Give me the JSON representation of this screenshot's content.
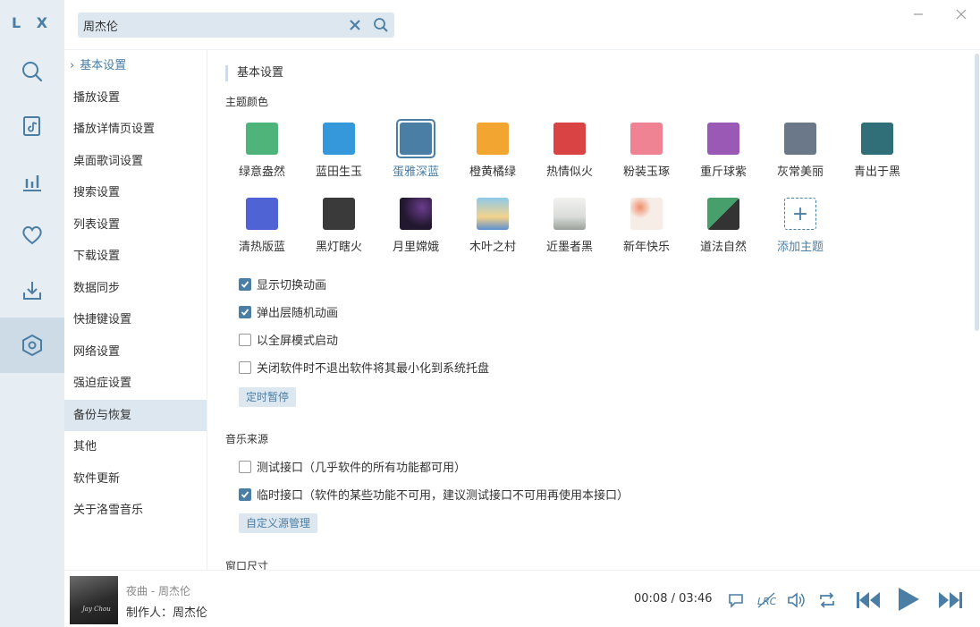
{
  "app": {
    "logo": "L X"
  },
  "search": {
    "value": "周杰伦",
    "placeholder": ""
  },
  "submenu": {
    "items": [
      "基本设置",
      "播放设置",
      "播放详情页设置",
      "桌面歌词设置",
      "搜索设置",
      "列表设置",
      "下载设置",
      "数据同步",
      "快捷键设置",
      "网络设置",
      "强迫症设置",
      "备份与恢复",
      "其他",
      "软件更新",
      "关于洛雪音乐"
    ]
  },
  "content": {
    "section_title": "基本设置",
    "theme_title": "主题颜色",
    "themes": [
      {
        "name": "绿意盎然",
        "color": "#4fb47a"
      },
      {
        "name": "蓝田生玉",
        "color": "#3498db"
      },
      {
        "name": "蛋雅深蓝",
        "color": "#4a7ea5"
      },
      {
        "name": "橙黄橘绿",
        "color": "#f2a531"
      },
      {
        "name": "热情似火",
        "color": "#d94343"
      },
      {
        "name": "粉装玉琢",
        "color": "#ef8393"
      },
      {
        "name": "重斤球紫",
        "color": "#9b59b6"
      },
      {
        "name": "灰常美丽",
        "color": "#6b7889"
      },
      {
        "name": "青出于黑",
        "color": "#306e78"
      },
      {
        "name": "清热版蓝",
        "color": "#4f63d4"
      },
      {
        "name": "黑灯瞎火",
        "color": "#3a3a3a"
      },
      {
        "name": "月里嫦娥",
        "color": "#22182f"
      },
      {
        "name": "木叶之村",
        "color": "#8ec9ea"
      },
      {
        "name": "近墨者黑",
        "color": "#d9dcd8"
      },
      {
        "name": "新年快乐",
        "color": "#f6ede7"
      },
      {
        "name": "道法自然",
        "color": "#47a06c"
      }
    ],
    "add_theme": "添加主题",
    "add_theme_glyph": "+",
    "checks": [
      {
        "label": "显示切换动画",
        "checked": true
      },
      {
        "label": "弹出层随机动画",
        "checked": true
      },
      {
        "label": "以全屏模式启动",
        "checked": false
      },
      {
        "label": "关闭软件时不退出软件将其最小化到系统托盘",
        "checked": false
      }
    ],
    "timer_button": "定时暂停",
    "music_source_title": "音乐来源",
    "sources": [
      {
        "label": "测试接口（几乎软件的所有功能都可用）",
        "checked": false
      },
      {
        "label": "临时接口（软件的某些功能不可用，建议测试接口不可用再使用本接口）",
        "checked": true
      }
    ],
    "custom_source_button": "自定义源管理",
    "window_size_title": "窗口尺寸"
  },
  "player": {
    "track": "夜曲 - 周杰伦",
    "producer": "制作人：周杰伦",
    "cover_text": "Jay Chou",
    "time": "00:08 / 03:46"
  },
  "colors": {
    "accent": "#4a7ea5",
    "rail_bg": "#e6edf3",
    "pill_bg": "#dde7ef"
  }
}
